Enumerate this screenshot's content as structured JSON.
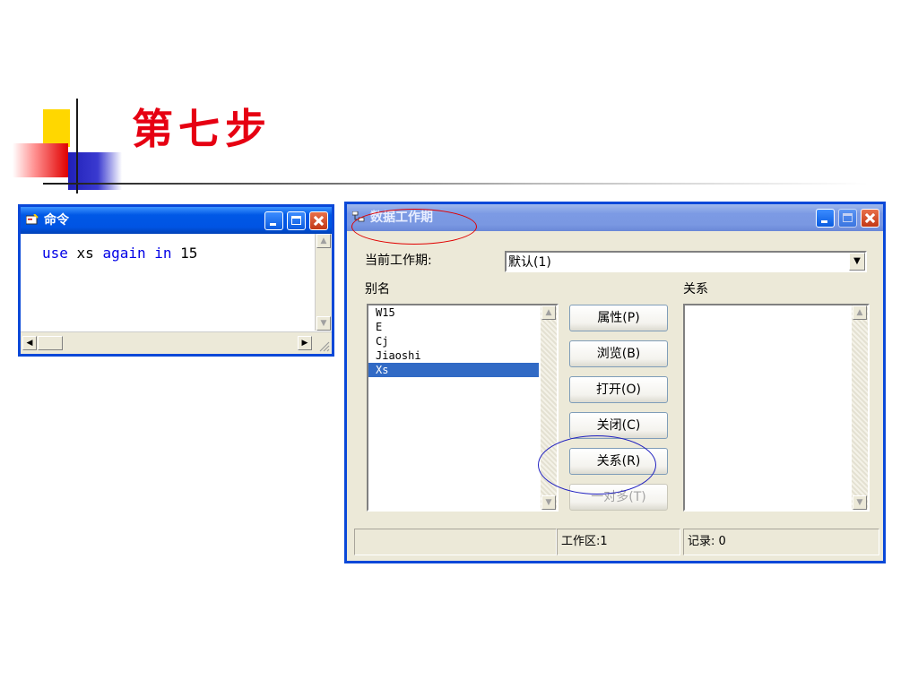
{
  "slide": {
    "title": "第七步"
  },
  "command_window": {
    "title": "命令",
    "code_tokens": [
      {
        "text": "use",
        "kw": true
      },
      {
        "text": " xs ",
        "kw": false
      },
      {
        "text": "again",
        "kw": true
      },
      {
        "text": " ",
        "kw": false
      },
      {
        "text": "in",
        "kw": true
      },
      {
        "text": " 15",
        "kw": false
      }
    ]
  },
  "data_session": {
    "title": "数据工作期",
    "current_session_label": "当前工作期:",
    "current_session_value": "默认(1)",
    "alias_label": "别名",
    "relation_label": "关系",
    "aliases": [
      "W15",
      "E",
      "Cj",
      "Jiaoshi",
      "Xs"
    ],
    "selected_alias": "Xs",
    "buttons": {
      "properties": "属性(P)",
      "browse": "浏览(B)",
      "open": "打开(O)",
      "close": "关闭(C)",
      "relations": "关系(R)",
      "one_to_many": "一对多(T)"
    },
    "status": {
      "left": "",
      "workarea": "工作区:1",
      "records": "记录: 0"
    }
  },
  "colors": {
    "title_red": "#e60012",
    "annotation_red": "#e00000",
    "annotation_blue": "#2020c0",
    "selection_blue": "#316ac5"
  }
}
